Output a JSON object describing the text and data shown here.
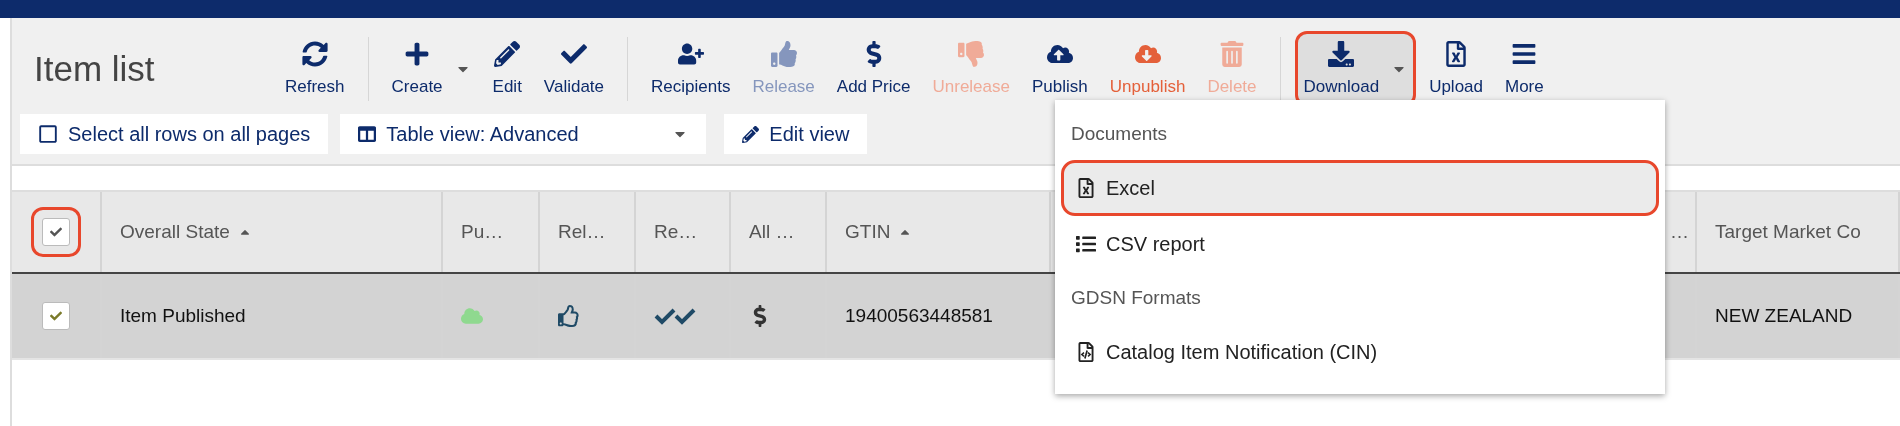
{
  "page_title": "Item list",
  "toolbar_groups": [
    [
      {
        "label": "Refresh",
        "disabled": false,
        "danger": false,
        "has_menu": false,
        "highlighted": false
      }
    ],
    [
      {
        "label": "Create",
        "disabled": false,
        "danger": false,
        "has_menu": true,
        "highlighted": false
      },
      {
        "label": "Edit",
        "disabled": false,
        "danger": false,
        "has_menu": false,
        "highlighted": false
      },
      {
        "label": "Validate",
        "disabled": false,
        "danger": false,
        "has_menu": false,
        "highlighted": false
      }
    ],
    [
      {
        "label": "Recipients",
        "disabled": false,
        "danger": false,
        "has_menu": false,
        "highlighted": false
      },
      {
        "label": "Release",
        "disabled": true,
        "danger": false,
        "has_menu": false,
        "highlighted": false
      },
      {
        "label": "Add Price",
        "disabled": false,
        "danger": false,
        "has_menu": false,
        "highlighted": false
      },
      {
        "label": "Unrelease",
        "disabled": true,
        "danger": true,
        "has_menu": false,
        "highlighted": false
      },
      {
        "label": "Publish",
        "disabled": false,
        "danger": false,
        "has_menu": false,
        "highlighted": false
      },
      {
        "label": "Unpublish",
        "disabled": false,
        "danger": true,
        "has_menu": false,
        "highlighted": false
      },
      {
        "label": "Delete",
        "disabled": true,
        "danger": true,
        "has_menu": false,
        "highlighted": false
      }
    ],
    [
      {
        "label": "Download",
        "disabled": false,
        "danger": false,
        "has_menu": true,
        "highlighted": true
      },
      {
        "label": "Upload",
        "disabled": false,
        "danger": false,
        "has_menu": false,
        "highlighted": false
      },
      {
        "label": "More",
        "disabled": false,
        "danger": false,
        "has_menu": false,
        "highlighted": false
      }
    ]
  ],
  "select_all": {
    "label": "Select all rows on all pages",
    "checked": false
  },
  "table_view": {
    "label": "Table view: Advanced"
  },
  "edit_view": {
    "label": "Edit view"
  },
  "table": {
    "header_checkbox": {
      "checked": true,
      "highlighted": true
    },
    "columns": [
      "Overall State",
      "Pu…",
      "Rel…",
      "Re…",
      "All …",
      "GTIN",
      "…",
      "Target Market Co"
    ],
    "sorted": [
      true,
      false,
      false,
      false,
      false,
      true,
      false,
      false
    ],
    "rows": [
      {
        "selected": true,
        "checked": true,
        "cells": [
          {
            "kind": "text",
            "text": "Item Published"
          },
          {
            "kind": "icon"
          },
          {
            "kind": "icon"
          },
          {
            "kind": "icon"
          },
          {
            "kind": "icon"
          },
          {
            "kind": "text",
            "text": "19400563448581"
          },
          {
            "kind": "empty"
          },
          {
            "kind": "text",
            "text": "NEW ZEALAND"
          }
        ]
      }
    ]
  },
  "download_menu": {
    "open": true,
    "sections": [
      {
        "heading": "Documents",
        "items": [
          {
            "label": "Excel",
            "selected": true
          },
          {
            "label": "CSV report",
            "selected": false
          }
        ]
      },
      {
        "heading": "GDSN Formats",
        "items": [
          {
            "label": "Catalog Item Notification (CIN)",
            "selected": false
          }
        ]
      }
    ]
  }
}
